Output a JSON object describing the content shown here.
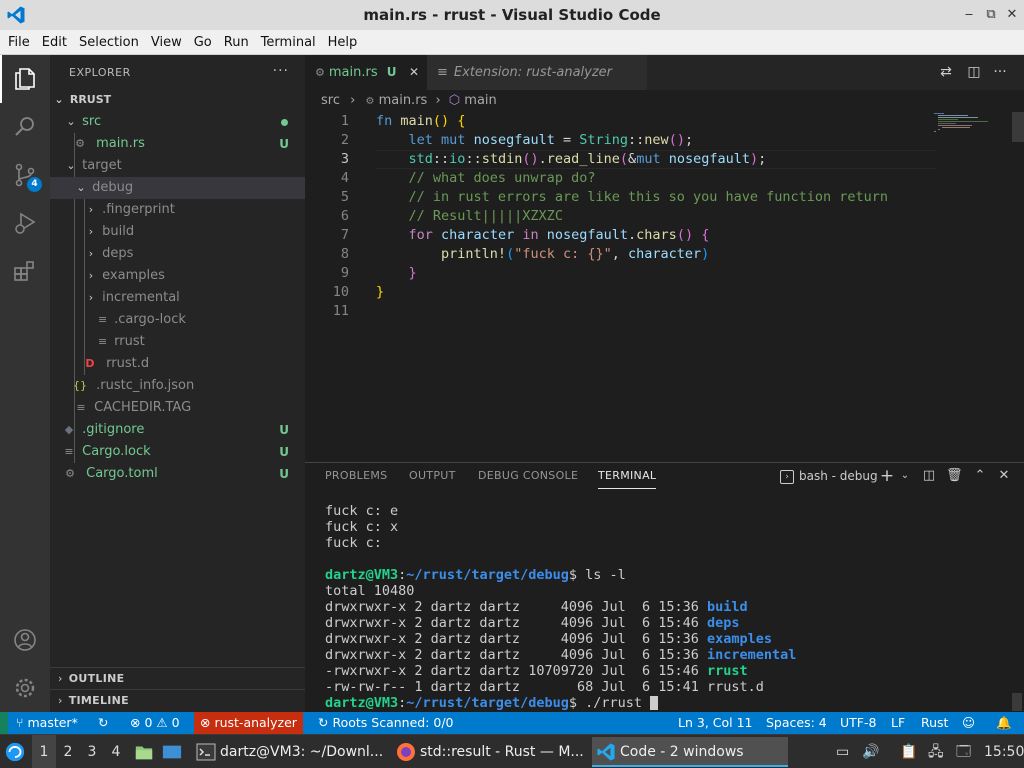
{
  "window": {
    "title": "main.rs - rrust - Visual Studio Code"
  },
  "menu": [
    "File",
    "Edit",
    "Selection",
    "View",
    "Go",
    "Run",
    "Terminal",
    "Help"
  ],
  "activity_bar": {
    "source_control_badge": "4"
  },
  "explorer": {
    "header": "EXPLORER",
    "more": "···",
    "root": "RRUST",
    "items": [
      {
        "label": "src",
        "deco": ""
      },
      {
        "label": "main.rs",
        "deco": "U"
      },
      {
        "label": "target",
        "deco": ""
      },
      {
        "label": "debug",
        "deco": ""
      },
      {
        "label": ".fingerprint",
        "deco": ""
      },
      {
        "label": "build",
        "deco": ""
      },
      {
        "label": "deps",
        "deco": ""
      },
      {
        "label": "examples",
        "deco": ""
      },
      {
        "label": "incremental",
        "deco": ""
      },
      {
        "label": ".cargo-lock",
        "deco": ""
      },
      {
        "label": "rrust",
        "deco": ""
      },
      {
        "label": "rrust.d",
        "deco": ""
      },
      {
        "label": ".rustc_info.json",
        "deco": ""
      },
      {
        "label": "CACHEDIR.TAG",
        "deco": ""
      },
      {
        "label": ".gitignore",
        "deco": "U"
      },
      {
        "label": "Cargo.lock",
        "deco": "U"
      },
      {
        "label": "Cargo.toml",
        "deco": "U"
      }
    ],
    "outline": "OUTLINE",
    "timeline": "TIMELINE"
  },
  "tabs": [
    {
      "label": "main.rs",
      "modified": "U"
    },
    {
      "label": "Extension: rust-analyzer"
    }
  ],
  "breadcrumb": {
    "part1": "src",
    "sep": "›",
    "part2": "main.rs",
    "part3": "main"
  },
  "code": {
    "line_numbers": [
      "1",
      "2",
      "3",
      "4",
      "5",
      "6",
      "7",
      "8",
      "9",
      "10",
      "11"
    ],
    "current_line": 3
  },
  "panel": {
    "tabs": [
      "PROBLEMS",
      "OUTPUT",
      "DEBUG CONSOLE",
      "TERMINAL"
    ],
    "active_tab": "TERMINAL",
    "terminal_selector": "bash - debug",
    "terminal": {
      "lines_top": [
        "fuck c: e",
        "fuck c: x",
        "fuck c:",
        ""
      ],
      "prompt_user": "dartz@VM3",
      "prompt_path": "~/rrust/target/debug",
      "cmd1": "ls -l",
      "total": "total 10480",
      "listing": [
        {
          "meta": "drwxrwxr-x 2 dartz dartz     4096 Jul  6 15:36 ",
          "name": "build",
          "kind": "dir"
        },
        {
          "meta": "drwxrwxr-x 2 dartz dartz     4096 Jul  6 15:46 ",
          "name": "deps",
          "kind": "dir"
        },
        {
          "meta": "drwxrwxr-x 2 dartz dartz     4096 Jul  6 15:36 ",
          "name": "examples",
          "kind": "dir"
        },
        {
          "meta": "drwxrwxr-x 2 dartz dartz     4096 Jul  6 15:36 ",
          "name": "incremental",
          "kind": "dir"
        },
        {
          "meta": "-rwxrwxr-x 2 dartz dartz 10709720 Jul  6 15:46 ",
          "name": "rrust",
          "kind": "exec"
        },
        {
          "meta": "-rw-rw-r-- 1 dartz dartz       68 Jul  6 15:41 ",
          "name": "rrust.d",
          "kind": "file"
        }
      ],
      "cmd2": "./rrust"
    }
  },
  "status": {
    "branch": "master*",
    "errors": "0",
    "warnings": "0",
    "analyzer": "rust-analyzer",
    "roots": "Roots Scanned: 0/0",
    "position": "Ln 3, Col 11",
    "spaces": "Spaces: 4",
    "encoding": "UTF-8",
    "eol": "LF",
    "language": "Rust"
  },
  "taskbar": {
    "workspaces": [
      "1",
      "2",
      "3",
      "4"
    ],
    "tasks": [
      {
        "label": "dartz@VM3: ~/Downl..."
      },
      {
        "label": "std::result - Rust — M..."
      },
      {
        "label": "Code - 2 windows"
      }
    ],
    "clock": "15:50"
  },
  "colors": {
    "accent": "#007acc",
    "untracked": "#73c991",
    "error_status": "#c72e0f"
  }
}
